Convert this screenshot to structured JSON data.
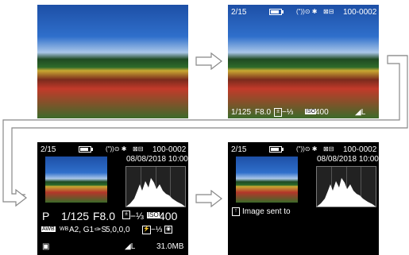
{
  "screen2": {
    "index": "2/15",
    "icons": "(ʺ))⊙ ✱",
    "folder_icons": "⊠⊟",
    "file_no": "100-0002",
    "shutter": "1/125",
    "aperture": "F8.0",
    "exposure_comp": "−⅓",
    "iso_label": "ISO",
    "iso_value": "400",
    "quality": "L"
  },
  "screen3": {
    "index": "2/15",
    "file_no": "100-0002",
    "date": "08/08/2018 10:00:00",
    "mode": "P",
    "shutter": "1/125",
    "aperture": "F8.0",
    "exposure_comp": "−⅓",
    "iso_label": "ISO",
    "iso_value": "400",
    "awb": "AWB",
    "wb_shift": "A2, G1",
    "picture_style": "5,0,0,0",
    "flash_comp": "−⅓",
    "quality": "L",
    "size": "31.0MB"
  },
  "screen4": {
    "index": "2/15",
    "file_no": "100-0002",
    "date": "08/08/2018 10:00:00",
    "message": "Image sent to"
  }
}
